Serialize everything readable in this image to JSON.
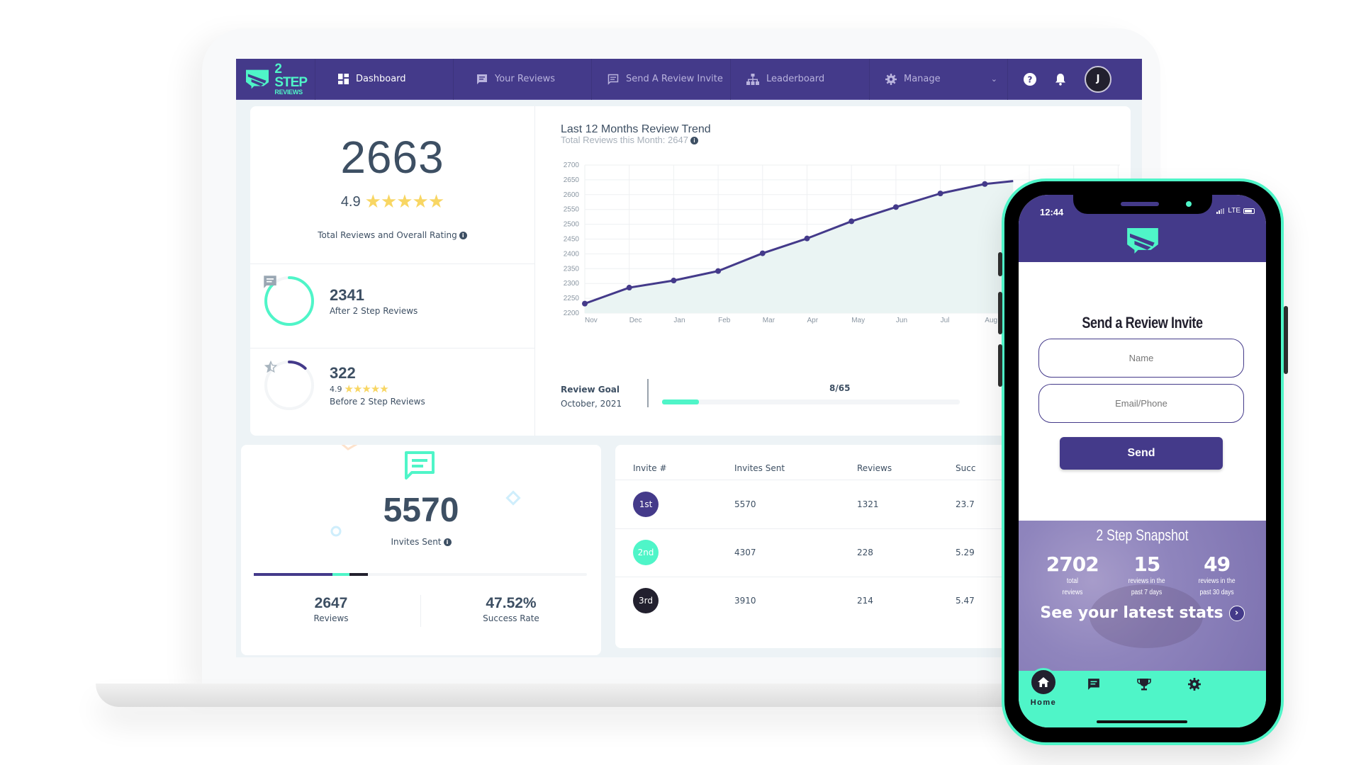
{
  "brand": {
    "line1": "2 STEP",
    "line2": "REVIEWS",
    "primary": "#443a8a",
    "accent": "#4ff5c8"
  },
  "nav": {
    "items": [
      {
        "label": "Dashboard",
        "icon": "dashboard-icon",
        "active": true
      },
      {
        "label": "Your Reviews",
        "icon": "message-icon"
      },
      {
        "label": "Send A Review Invite",
        "icon": "message-outline-icon"
      },
      {
        "label": "Leaderboard",
        "icon": "sitemap-icon"
      },
      {
        "label": "Manage",
        "icon": "gear-icon"
      }
    ],
    "avatar_initial": "J"
  },
  "overview": {
    "total_reviews": "2663",
    "overall_rating": "4.9",
    "stars": "★★★★★",
    "caption": "Total Reviews and Overall Rating",
    "after": {
      "value": "2341",
      "label": "After 2 Step Reviews",
      "ring_fraction": 0.88
    },
    "before": {
      "value": "322",
      "rating": "4.9",
      "stars": "★★★★★",
      "label": "Before 2 Step Reviews",
      "ring_fraction": 0.12
    }
  },
  "trend": {
    "review_goal_label": "Review Goal",
    "review_goal_month": "October, 2021",
    "review_goal_value": "8/65",
    "review_goal_fraction": 0.123
  },
  "chart_data": {
    "type": "area",
    "title": "Last 12 Months Review Trend",
    "subtitle": "Total Reviews this Month: 2647",
    "categories": [
      "Nov",
      "Dec",
      "Jan",
      "Feb",
      "Mar",
      "Apr",
      "May",
      "Jun",
      "Jul",
      "Aug"
    ],
    "values": [
      2232,
      2286,
      2310,
      2342,
      2402,
      2452,
      2510,
      2558,
      2604,
      2636
    ],
    "yticks": [
      2200,
      2250,
      2300,
      2350,
      2400,
      2450,
      2500,
      2550,
      2600,
      2650,
      2700
    ],
    "ylim": [
      2200,
      2700
    ],
    "xlabel": "",
    "ylabel": "",
    "grid": true,
    "line_color": "#443a8a",
    "fill_color": "#eaf4f3"
  },
  "invites": {
    "count": "5570",
    "label": "Invites Sent",
    "bar_segments": [
      {
        "fraction": 0.237,
        "color": "#443a8a"
      },
      {
        "fraction": 0.051,
        "color": "#4ff5c8"
      },
      {
        "fraction": 0.055,
        "color": "#22202e"
      }
    ],
    "reviews": "2647",
    "reviews_label": "Reviews",
    "success_rate": "47.52%",
    "success_label": "Success Rate"
  },
  "invite_table": {
    "headers": [
      "Invite #",
      "Invites Sent",
      "Reviews",
      "Succ"
    ],
    "rows": [
      {
        "badge": "1st",
        "color": "#443a8a",
        "sent": "5570",
        "reviews": "1321",
        "rate": "23.7"
      },
      {
        "badge": "2nd",
        "color": "#4ff5c8",
        "sent": "4307",
        "reviews": "228",
        "rate": "5.29"
      },
      {
        "badge": "3rd",
        "color": "#22202e",
        "sent": "3910",
        "reviews": "214",
        "rate": "5.47"
      }
    ]
  },
  "phone": {
    "time": "12:44",
    "network": "LTE",
    "title": "Send a Review Invite",
    "name_placeholder": "Name",
    "contact_placeholder": "Email/Phone",
    "send_label": "Send",
    "snapshot": {
      "title": "2 Step Snapshot",
      "stats": [
        {
          "value": "2702",
          "label1": "total",
          "label2": "reviews"
        },
        {
          "value": "15",
          "label1": "reviews in the",
          "label2": "past 7 days"
        },
        {
          "value": "49",
          "label1": "reviews in the",
          "label2": "past 30 days"
        }
      ],
      "cta": "See your latest stats"
    },
    "tabs": [
      {
        "label": "Home",
        "icon": "home-icon",
        "active": true
      },
      {
        "label": "",
        "icon": "message-icon"
      },
      {
        "label": "",
        "icon": "trophy-icon"
      },
      {
        "label": "",
        "icon": "gear-icon"
      }
    ]
  }
}
